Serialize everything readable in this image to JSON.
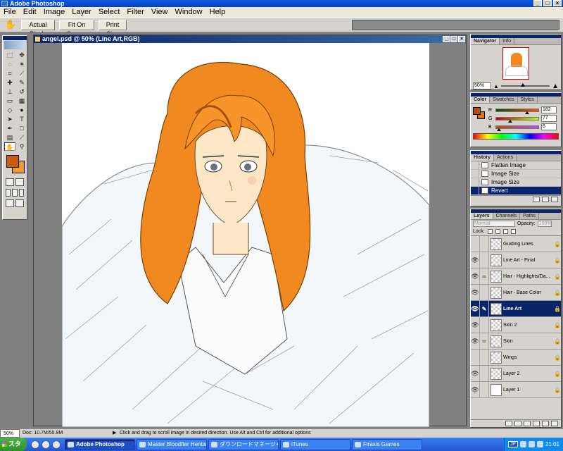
{
  "window": {
    "title": "Adobe Photoshop"
  },
  "menu": [
    "File",
    "Edit",
    "Image",
    "Layer",
    "Select",
    "Filter",
    "View",
    "Window",
    "Help"
  ],
  "options_bar": {
    "buttons": [
      "Actual Pixels",
      "Fit On Screen",
      "Print Size"
    ]
  },
  "document": {
    "title": "angel.psd @ 50% (Line Art,RGB)"
  },
  "colors": {
    "foreground": "#c95a0f",
    "background": "#f19a2a",
    "accent": "#0a246a"
  },
  "navigator": {
    "tabs": [
      "Navigator",
      "Info"
    ],
    "zoom": "50%"
  },
  "color_palette": {
    "tabs": [
      "Color",
      "Swatches",
      "Styles"
    ],
    "channels": [
      {
        "label": "R",
        "value": "182",
        "fraction": 0.71
      },
      {
        "label": "G",
        "value": "77",
        "fraction": 0.3
      },
      {
        "label": "B",
        "value": "6",
        "fraction": 0.02
      }
    ]
  },
  "history": {
    "tabs": [
      "History",
      "Actions"
    ],
    "items": [
      "Flatten Image",
      "Image Size",
      "Image Size",
      "Revert"
    ]
  },
  "layers_palette": {
    "tabs": [
      "Layers",
      "Channels",
      "Paths"
    ],
    "blend_mode": "Normal",
    "opacity_label": "Opacity:",
    "opacity": "100%",
    "lock_label": "Lock:",
    "layers": [
      {
        "name": "Guiding Lines",
        "visible": false,
        "locked": true
      },
      {
        "name": "Line Art - Final",
        "visible": true,
        "locked": true
      },
      {
        "name": "Hair - Highlights/Da...",
        "visible": true,
        "locked": true
      },
      {
        "name": "Hair - Base Color",
        "visible": true,
        "locked": true
      },
      {
        "name": "Line Art",
        "visible": true,
        "locked": true,
        "active": true
      },
      {
        "name": "Skin 2",
        "visible": true,
        "locked": true
      },
      {
        "name": "Skin",
        "visible": true,
        "locked": true
      },
      {
        "name": "Wings",
        "visible": false,
        "locked": true
      },
      {
        "name": "Layer 2",
        "visible": true,
        "locked": true
      },
      {
        "name": "Layer 1",
        "visible": true,
        "locked": true
      }
    ]
  },
  "status": {
    "zoom": "50%",
    "doc": "Doc: 10.7M/55.8M",
    "hint": "Click and drag to scroll image in desired direction.  Use Alt and Ctrl for additional options"
  },
  "taskbar": {
    "start": "スタート",
    "tasks": [
      "Adobe Photoshop",
      "Master Bloodfter Hentai ...",
      "ダウンロードマネージャ",
      "iTunes",
      "Firaxis Games"
    ],
    "active_task": 0,
    "ime": "JP",
    "time": "21:01"
  }
}
